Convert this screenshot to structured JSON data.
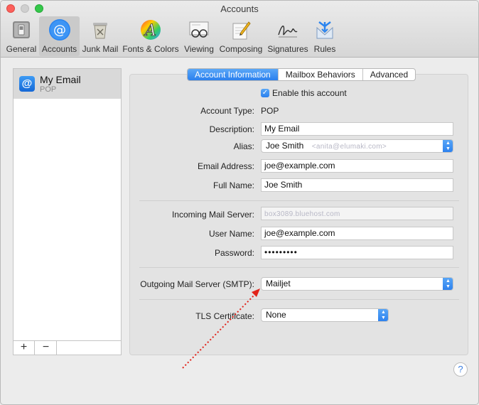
{
  "window": {
    "title": "Accounts"
  },
  "toolbar": {
    "items": [
      {
        "label": "General",
        "icon": "switch-icon"
      },
      {
        "label": "Accounts",
        "icon": "at-icon",
        "selected": true
      },
      {
        "label": "Junk Mail",
        "icon": "trash-bin-icon"
      },
      {
        "label": "Fonts & Colors",
        "icon": "font-icon"
      },
      {
        "label": "Viewing",
        "icon": "glasses-icon"
      },
      {
        "label": "Composing",
        "icon": "pencil-icon"
      },
      {
        "label": "Signatures",
        "icon": "signature-icon"
      },
      {
        "label": "Rules",
        "icon": "rules-icon"
      }
    ]
  },
  "sidebar": {
    "accounts": [
      {
        "name": "My Email",
        "type": "POP"
      }
    ],
    "add_label": "+",
    "remove_label": "−"
  },
  "tabs": [
    {
      "label": "Account Information",
      "active": true
    },
    {
      "label": "Mailbox Behaviors"
    },
    {
      "label": "Advanced"
    }
  ],
  "form": {
    "enable_label": "Enable this account",
    "account_type_label": "Account Type:",
    "account_type_value": "POP",
    "description_label": "Description:",
    "description_value": "My Email",
    "alias_label": "Alias:",
    "alias_value": "Joe Smith",
    "alias_email_blurred": "<anita@elumaki.com>",
    "email_label": "Email Address:",
    "email_value": "joe@example.com",
    "fullname_label": "Full Name:",
    "fullname_value": "Joe Smith",
    "incoming_label": "Incoming Mail Server:",
    "incoming_value_blurred": "box3089.bluehost.com",
    "username_label": "User Name:",
    "username_value": "joe@example.com",
    "password_label": "Password:",
    "password_value": "•••••••••",
    "smtp_label": "Outgoing Mail Server (SMTP):",
    "smtp_value": "Mailjet",
    "tls_label": "TLS Certificate:",
    "tls_value": "None"
  },
  "help_label": "?",
  "colors": {
    "accent": "#2b80ee",
    "annotation_arrow": "#e2231a"
  }
}
